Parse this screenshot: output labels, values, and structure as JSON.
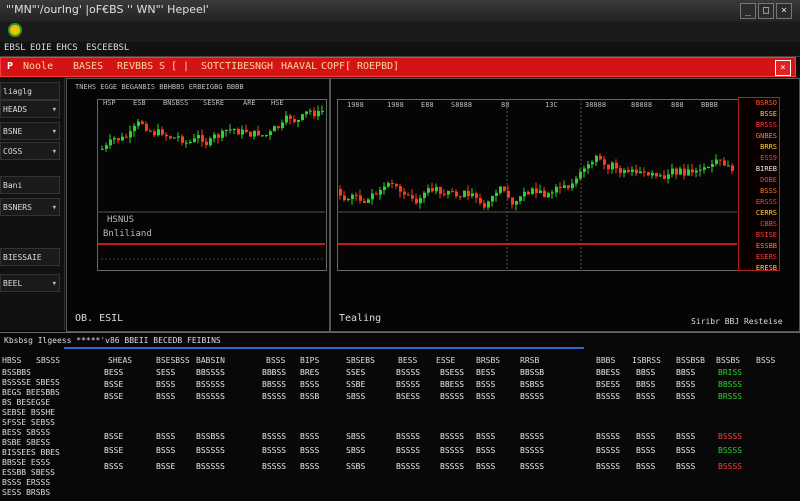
{
  "window": {
    "title": "\"'MN\"'/ourlng' |oF€BS '' WN\"' Hepeel'",
    "close_label": "×",
    "minimize_label": "_",
    "maximize_label": "□"
  },
  "menubar": {
    "items": [
      "EBSL",
      "EOIE",
      "EHCS",
      "ESCEEBSL"
    ]
  },
  "redbar": {
    "items": [
      "P",
      "Noole",
      "BASES",
      "REVBBS",
      "S",
      "[",
      "|",
      "SOTCTIBE",
      "SNGH",
      "HAAVAL",
      "COPF",
      "[",
      "ROEPBD",
      "]"
    ],
    "close_label": "×"
  },
  "left_panel": {
    "items": [
      "liaglg",
      "HEADS",
      "BSNE",
      "COSS",
      "Bani",
      "BSNERS",
      "BIESSAIE",
      "BEEL"
    ]
  },
  "chart1": {
    "header": "TNEHS EGGE BEGANBIS BBHBBS ERBEIGBG BBBB",
    "ticks": [
      "HSP",
      "ESB",
      "BNSBSS",
      "SESRE",
      "ARE",
      "HSE"
    ],
    "label_top": "HSNUS",
    "label_bottom": "Bnliliand",
    "bottom_text": "OB. ESIL"
  },
  "chart2": {
    "ticks": [
      "1988",
      "1988",
      "E88",
      "S8888",
      "88",
      "13C",
      "38888",
      "88888",
      "888",
      "BBBB"
    ],
    "bottom_left": "Tealing",
    "bottom_right": "Siribr BBJ Resteise"
  },
  "price_column": {
    "rows": [
      "BSRSO",
      "BSSE",
      "BRSSS",
      "GNBES",
      "BRRS",
      "ESS9",
      "BIREB",
      "DOBE",
      "BSSS",
      "ERSSS",
      "CERRS",
      "CBBS",
      "BSISE",
      "ESSBB",
      "ESERS",
      "ERESB"
    ],
    "colors": [
      "#ff5b2a",
      "#ffd22a",
      "#ff3d3d",
      "#ff7b2a",
      "#ffd22a",
      "#ff3d3d",
      "#e6e6e6",
      "#ff3d3d",
      "#ff7b2a",
      "#ff3d3d",
      "#ffd22a",
      "#ff3d3d",
      "#ff3d3d",
      "#ff7b2a",
      "#ff3d3d",
      "#ffd22a"
    ]
  },
  "table": {
    "title": "Kbsbsg Ilgeess *****'v86 BBEII BECEDB FEIBINS",
    "headers": [
      "HBSS",
      "SBSSS",
      "SHEAS",
      "BSESBSS",
      "BABSIN",
      "BSSS",
      "BIPS",
      "SBSEBS",
      "BESS",
      "ESSE",
      "BRSBS",
      "RRSB",
      "BBBS",
      "ISBRSS",
      "BSSBSB",
      "BSSBS",
      "BSSS"
    ],
    "left_rows": [
      "BSSBBS",
      "BSSSSE SBESS",
      "BEGS BEESBBS",
      "BS BESEGSE",
      "SEBSE BSSHE",
      "SFSSE SEBSS",
      "BESS SBSSS",
      "BSBE SBESS",
      "BISSEES BBES",
      "BBSSE ESSS",
      "ESSBB SBESS",
      "BSSS ERSSS",
      "SESS BRSBS"
    ],
    "data_rows": [
      [
        "BESS",
        "SESS",
        "BBSSSS",
        "BBBSS",
        "BRES",
        "SSES",
        "BSSSS",
        "BSESS",
        "BESS",
        "BBSSB",
        "BBESS",
        "BBSS",
        "BBSS",
        "BRISS"
      ],
      [
        "BSSE",
        "BSSS",
        "BSSSSS",
        "BBSSS",
        "BSSS",
        "SSBE",
        "BSSSS",
        "BBESS",
        "BSSS",
        "BSBSS",
        "BSESS",
        "BBSS",
        "BSSS",
        "BBSSS"
      ],
      [
        "BSSE",
        "BSSS",
        "BSSSSS",
        "BSSSS",
        "BSSB",
        "SBSS",
        "BSESS",
        "BSSSS",
        "BSSS",
        "BSSSS",
        "BSSSS",
        "BSSS",
        "BSSS",
        "BRSSS"
      ],
      [
        "BSSE",
        "BSSS",
        "BSSBSS",
        "BSSSS",
        "BSSS",
        "SBSS",
        "BSSSS",
        "BSSSS",
        "BSSS",
        "BSSSS",
        "BSSSS",
        "BSSS",
        "BSSS",
        "BSSSS"
      ],
      [
        "BSSE",
        "BSSS",
        "BSSSSS",
        "BSSSS",
        "BSSS",
        "SBSS",
        "BSSSS",
        "BSSSS",
        "BSSS",
        "BSSSS",
        "BSSSS",
        "BSSS",
        "BSSS",
        "BSSSS"
      ],
      [
        "BSSS",
        "BSSE",
        "BSSSSS",
        "BSSSS",
        "BSSS",
        "SSBS",
        "BSSSS",
        "BSSSS",
        "BSSS",
        "BSSSS",
        "BSSSS",
        "BSSS",
        "BSSS",
        "BSSSS"
      ]
    ],
    "last_col_colors": [
      "#2ed12e",
      "#2ed12e",
      "#2ed12e",
      "#ff3d3d",
      "#2ed12e",
      "#ff3d3d"
    ]
  },
  "colors": {
    "up": "#2ed12e",
    "down": "#ff3b1a",
    "accent_red": "#d41414"
  }
}
